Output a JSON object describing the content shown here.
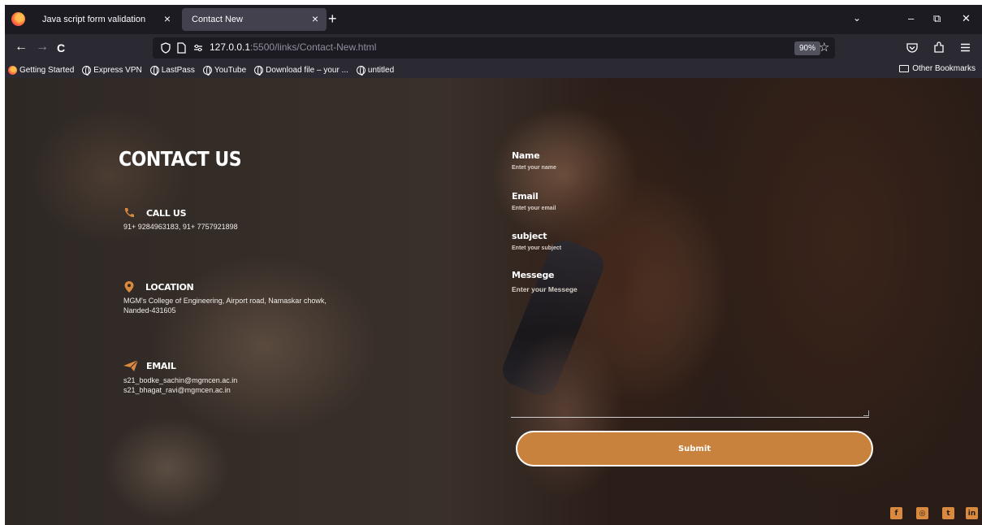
{
  "browser": {
    "tabs": [
      {
        "title": "Java script form validation",
        "close": "×"
      },
      {
        "title": "Contact New",
        "close": "×"
      }
    ],
    "new_tab": "+",
    "tab_list": "⌄",
    "window_controls": {
      "minimize": "–",
      "restore": "⧉",
      "close": "✕"
    },
    "nav": {
      "back": "←",
      "forward": "→",
      "reload": "C"
    },
    "url": {
      "host": "127.0.0.1",
      "rest": ":5500/links/Contact-New.html"
    },
    "zoom": "90%",
    "bookmarks": [
      {
        "label": "Getting Started",
        "icon": "firefox-icon"
      },
      {
        "label": "Express VPN",
        "icon": "globe-icon"
      },
      {
        "label": "LastPass",
        "icon": "globe-icon"
      },
      {
        "label": "YouTube",
        "icon": "globe-icon"
      },
      {
        "label": "Download file – your ...",
        "icon": "globe-icon"
      },
      {
        "label": "untitled",
        "icon": "globe-icon"
      }
    ],
    "other_bookmarks": "Other Bookmarks"
  },
  "contact": {
    "title": "CONTACT US",
    "call": {
      "label": "CALL US",
      "text": "91+ 9284963183, 91+ 7757921898"
    },
    "location": {
      "label": "LOCATION",
      "line1": "MGM's College of Engineering, Airport road, Namaskar chowk,",
      "line2": "Nanded-431605"
    },
    "email": {
      "label": "EMAIL",
      "line1": "s21_bodke_sachin@mgmcen.ac.in",
      "line2": "s21_bhagat_ravi@mgmcen.ac.in"
    }
  },
  "form": {
    "name": {
      "label": "Name",
      "placeholder": "Entet your name"
    },
    "email": {
      "label": "Email",
      "placeholder": "Entet your email"
    },
    "subject": {
      "label": "subject",
      "placeholder": "Entet your subject"
    },
    "message": {
      "label": "Messege",
      "placeholder": "Enter your Messege"
    },
    "submit": "Submit"
  },
  "social": [
    {
      "name": "facebook",
      "glyph": "f"
    },
    {
      "name": "instagram",
      "glyph": "◎"
    },
    {
      "name": "twitter",
      "glyph": "t"
    },
    {
      "name": "linkedin",
      "glyph": "in"
    }
  ],
  "colors": {
    "accent": "#d98a3f",
    "button": "#c9813e",
    "chrome_dark": "#1c1b22",
    "chrome": "#2b2a33"
  }
}
